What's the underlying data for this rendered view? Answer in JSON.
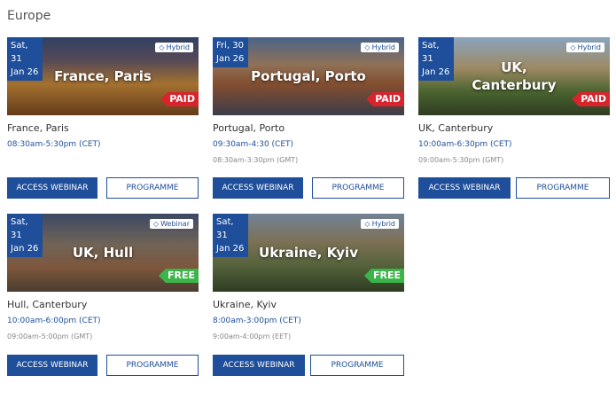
{
  "region": "Europe",
  "buttons": {
    "access": "ACCESS WEBINAR",
    "programme": "PROGRAMME"
  },
  "events": [
    {
      "day": "Sat, 31",
      "month": "Jan 26",
      "type": "Hybrid",
      "city": "France, Paris",
      "price": "PAID",
      "name": "France,  Paris",
      "time1": "08:30am-5:30pm (CET)",
      "time2": ""
    },
    {
      "day": "Fri, 30",
      "month": "Jan 26",
      "type": "Hybrid",
      "city": "Portugal, Porto",
      "price": "PAID",
      "name": "Portugal,  Porto",
      "time1": "09:30am-4:30 (CET)",
      "time2": "08:30am-3:30pm (GMT)"
    },
    {
      "day": "Sat, 31",
      "month": "Jan 26",
      "type": "Hybrid",
      "city": "UK, Canterbury",
      "price": "PAID",
      "name": "UK, Canterbury",
      "time1": "10:00am-6:30pm (CET)",
      "time2": "09:00am-5:30pm (GMT)"
    },
    {
      "day": "Sat, 31",
      "month": "Jan 26",
      "type": "Webinar",
      "city": "UK, Hull",
      "price": "FREE",
      "name": "Hull, Canterbury",
      "time1": "10:00am-6:00pm (CET)",
      "time2": "09:00am-5:00pm (GMT)"
    },
    {
      "day": "Sat, 31",
      "month": "Jan 26",
      "type": "Hybrid",
      "city": "Ukraine, Kyiv",
      "price": "FREE",
      "name": "Ukraine,  Kyiv",
      "time1": "8:00am-3:00pm (CET)",
      "time2": "9:00am-4:00pm (EET)"
    }
  ],
  "icons": {
    "tag": "tag-icon"
  },
  "colors": {
    "primary": "#1f4e9a",
    "paid": "#d9232d",
    "free": "#3bb54a"
  }
}
